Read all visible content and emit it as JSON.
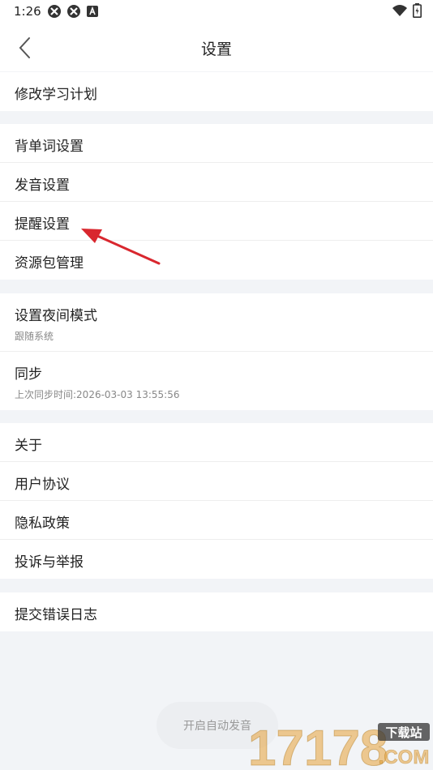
{
  "status_bar": {
    "time": "1:26",
    "icons": [
      "app-icon-1",
      "app-icon-2",
      "a-badge-icon",
      "wifi-icon",
      "battery-icon"
    ]
  },
  "header": {
    "title": "设置",
    "back_icon": "chevron-left-icon"
  },
  "groups": [
    {
      "items": [
        {
          "id": "study-plan",
          "label": "修改学习计划"
        }
      ]
    },
    {
      "items": [
        {
          "id": "word-settings",
          "label": "背单词设置"
        },
        {
          "id": "pronunciation",
          "label": "发音设置"
        },
        {
          "id": "reminder",
          "label": "提醒设置"
        },
        {
          "id": "resource-pack",
          "label": "资源包管理"
        }
      ]
    },
    {
      "items": [
        {
          "id": "night-mode",
          "label": "设置夜间模式",
          "sub": "跟随系统"
        },
        {
          "id": "sync",
          "label": "同步",
          "sub": "上次同步时间:2026-03-03 13:55:56"
        }
      ]
    },
    {
      "items": [
        {
          "id": "about",
          "label": "关于"
        },
        {
          "id": "user-agreement",
          "label": "用户协议"
        },
        {
          "id": "privacy",
          "label": "隐私政策"
        },
        {
          "id": "complaint",
          "label": "投诉与举报"
        }
      ]
    },
    {
      "items": [
        {
          "id": "error-log",
          "label": "提交错误日志"
        }
      ]
    }
  ],
  "toast": {
    "text": "开启自动发音"
  },
  "watermark": {
    "text": "17178",
    "badge": "下载站",
    "domain": ".COM"
  },
  "colors": {
    "background": "#f2f4f7",
    "surface": "#ffffff",
    "divider": "#eeeeee",
    "annotation_arrow": "#d9272e",
    "watermark": "#e8a33a"
  }
}
